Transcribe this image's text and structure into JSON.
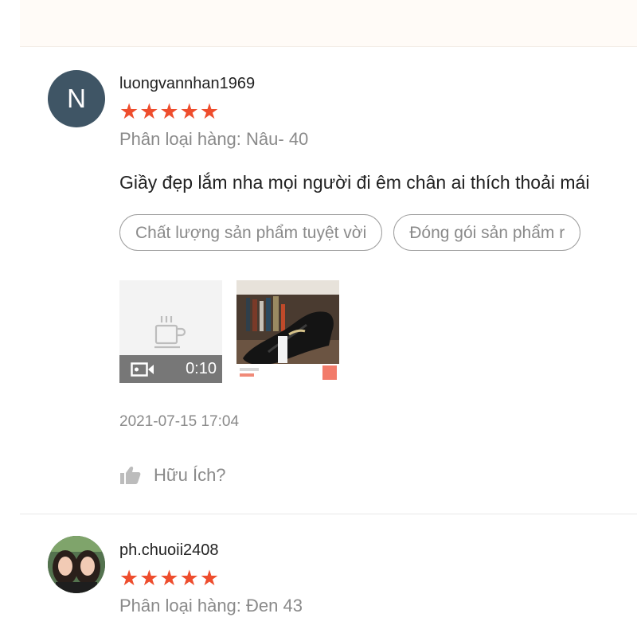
{
  "reviews": [
    {
      "avatar_letter": "N",
      "username": "luongvannhan1969",
      "rating": 5,
      "stars": "★★★★★",
      "variant": "Phân loại hàng: Nâu- 40",
      "comment": "Giầy đẹp lắm nha mọi người đi êm chân ai thích thoải mái",
      "tags": [
        "Chất lượng sản phẩm tuyệt vời",
        "Đóng gói sản phẩm r"
      ],
      "video_duration": "0:10",
      "timestamp": "2021-07-15 17:04",
      "helpful_label": "Hữu Ích?"
    },
    {
      "username": "ph.chuoii2408",
      "rating": 5,
      "stars": "★★★★★",
      "variant": "Phân loại hàng: Đen 43"
    }
  ],
  "colors": {
    "star": "#ee4d2d",
    "avatar_bg": "#3f5565",
    "muted_text": "#8a8a8a"
  },
  "icons": {
    "video": "video-camera-icon",
    "placeholder": "coffee-cup-icon",
    "helpful": "thumbs-up-icon"
  }
}
